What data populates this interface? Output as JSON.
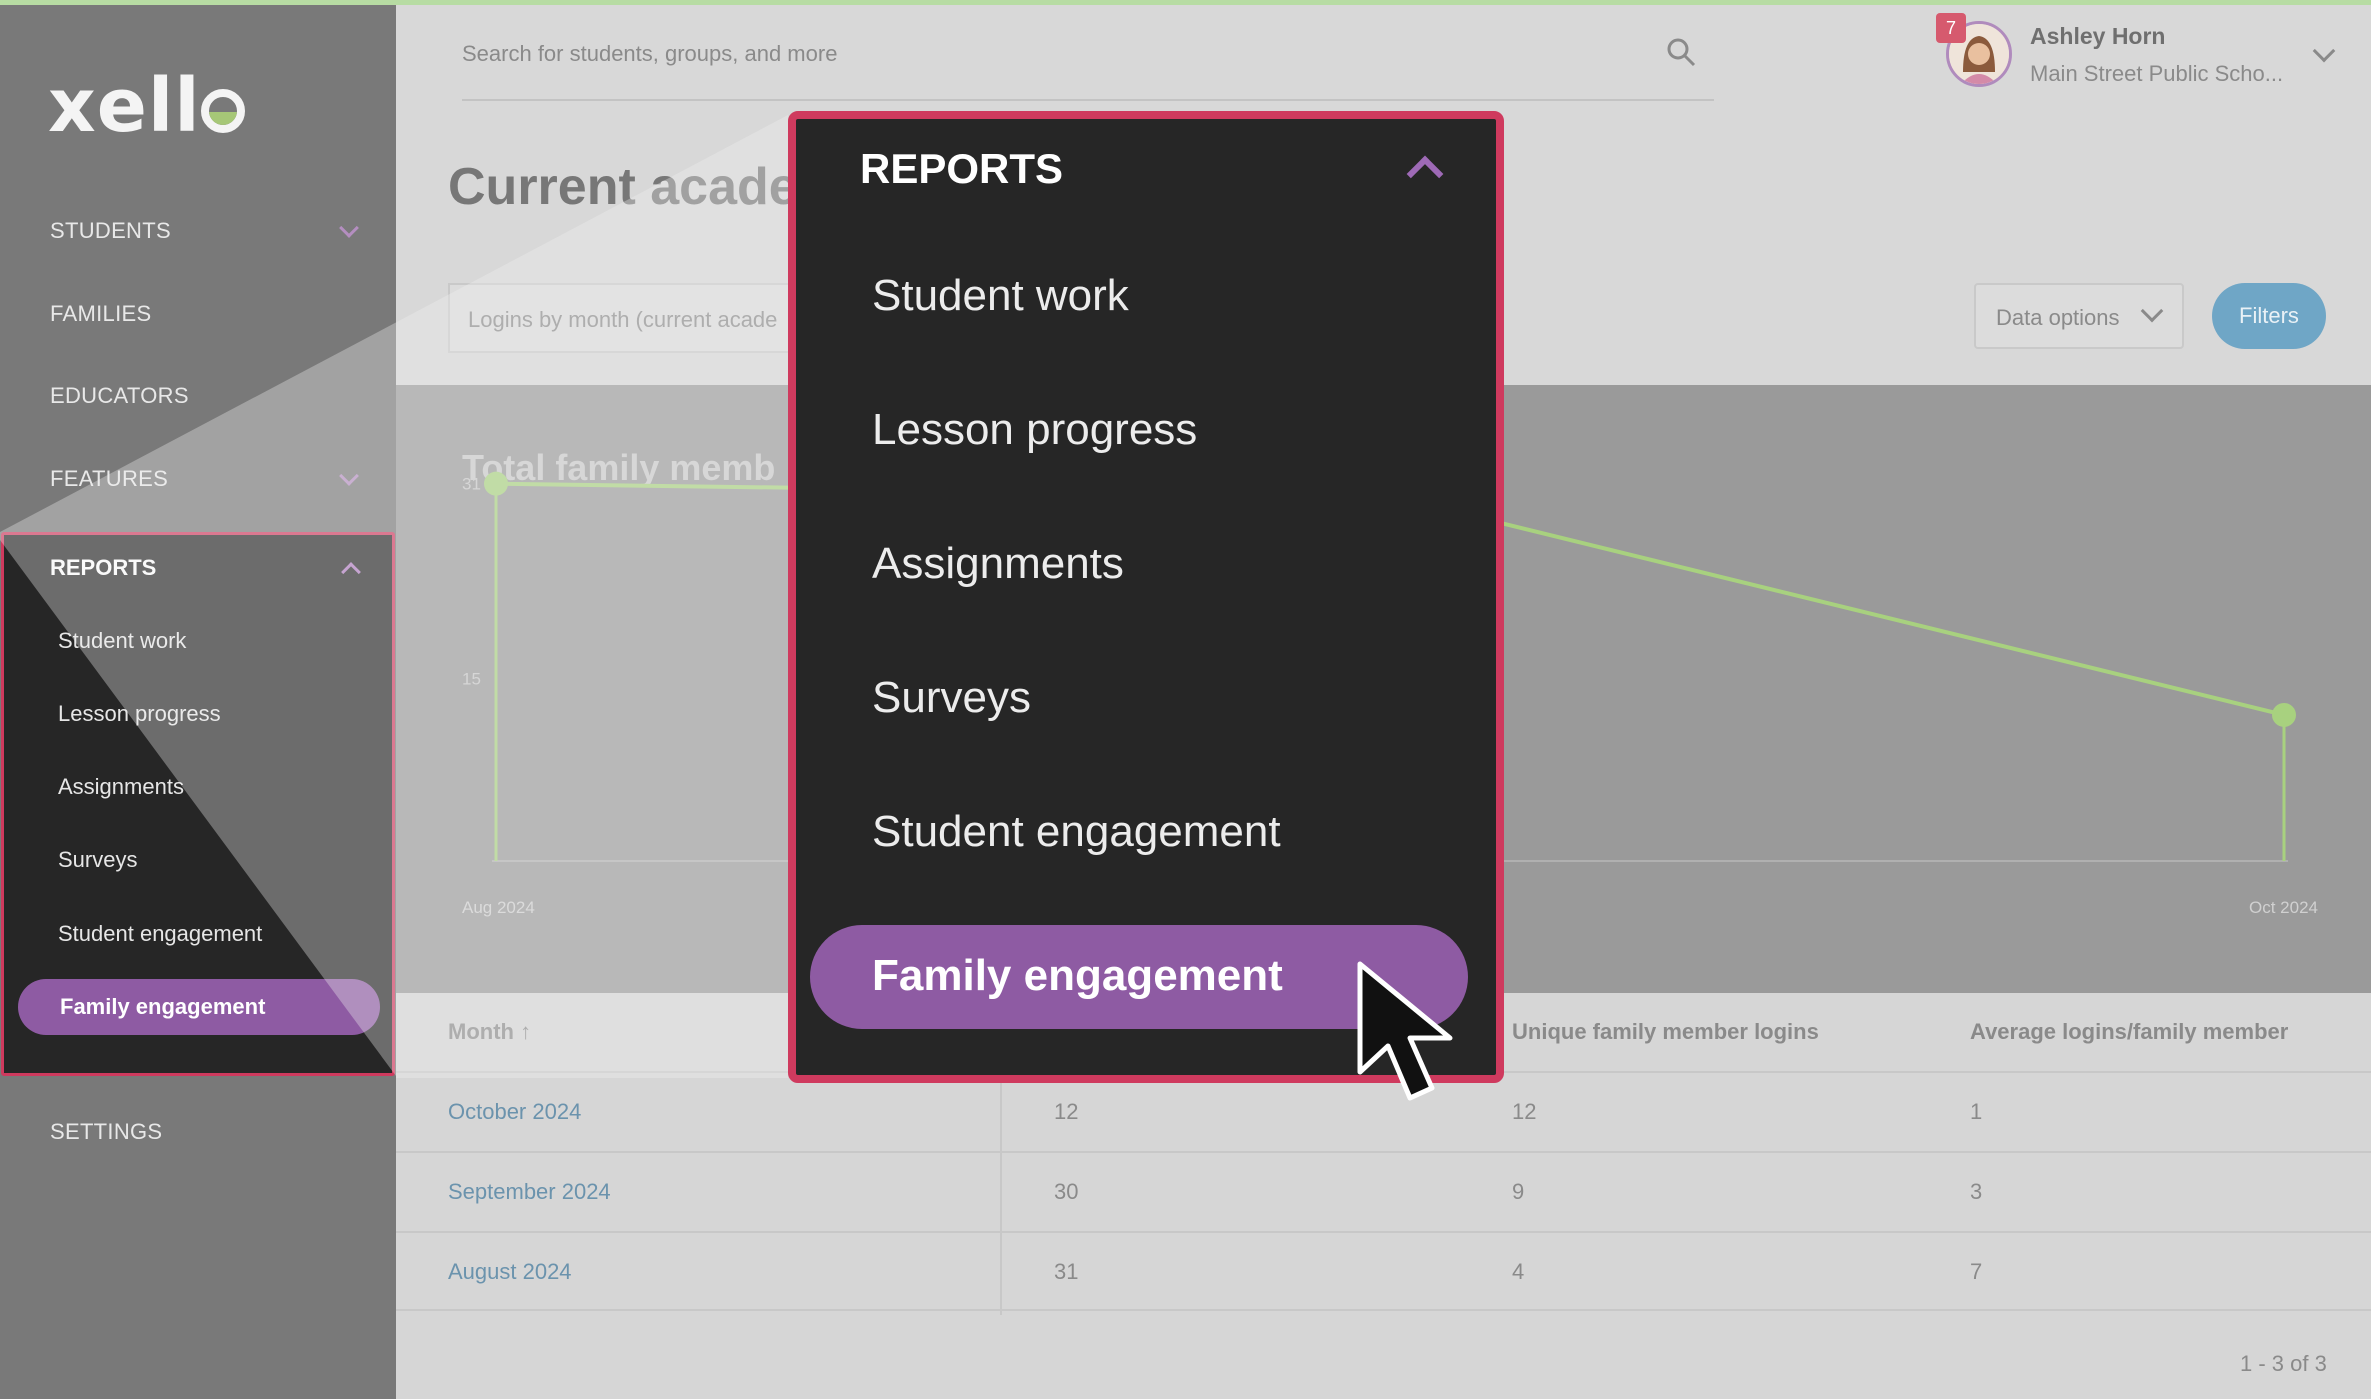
{
  "app": {
    "logo": "xello"
  },
  "sidebar": {
    "items": [
      {
        "label": "STUDENTS",
        "expandable": true
      },
      {
        "label": "FAMILIES",
        "expandable": false
      },
      {
        "label": "EDUCATORS",
        "expandable": false
      },
      {
        "label": "FEATURES",
        "expandable": true
      },
      {
        "label": "REPORTS",
        "expandable": true,
        "expanded": true
      },
      {
        "label": "SETTINGS",
        "expandable": false
      }
    ],
    "reports_submenu": [
      "Student work",
      "Lesson progress",
      "Assignments",
      "Surveys",
      "Student engagement",
      "Family engagement"
    ],
    "active_submenu": "Family engagement"
  },
  "header": {
    "search_placeholder": "Search for students, groups, and more",
    "notification_count": "7",
    "user_name": "Ashley Horn",
    "user_school": "Main Street Public Scho..."
  },
  "page": {
    "title": "Current acade",
    "report_select": "Logins by month (current acade",
    "data_options_label": "Data options",
    "filters_label": "Filters"
  },
  "chart_data": {
    "type": "line",
    "title": "Total family memb",
    "x": [
      "Aug 2024",
      "Sep 2024",
      "Oct 2024"
    ],
    "y": [
      31,
      30,
      12
    ],
    "y_ticks": [
      15,
      31
    ],
    "x_tick_labels": [
      "Aug 2024",
      "Oct 2024"
    ],
    "color": "#a8d17f",
    "ylim": [
      0,
      35
    ]
  },
  "table": {
    "columns": [
      "Month ↑",
      "",
      "Unique family member logins",
      "Average logins/family member"
    ],
    "rows": [
      [
        "October 2024",
        "12",
        "12",
        "1"
      ],
      [
        "September 2024",
        "30",
        "9",
        "3"
      ],
      [
        "August 2024",
        "31",
        "4",
        "7"
      ]
    ],
    "pager": "1 - 3 of 3"
  },
  "zoom": {
    "title": "REPORTS",
    "items": [
      "Student work",
      "Lesson progress",
      "Assignments",
      "Surveys",
      "Student engagement"
    ],
    "active": "Family engagement"
  },
  "colors": {
    "accent_purple": "#8e5ba3",
    "highlight_border": "#cf3a5e",
    "link_blue": "#6b93ad",
    "chart_green": "#a8d17f"
  }
}
